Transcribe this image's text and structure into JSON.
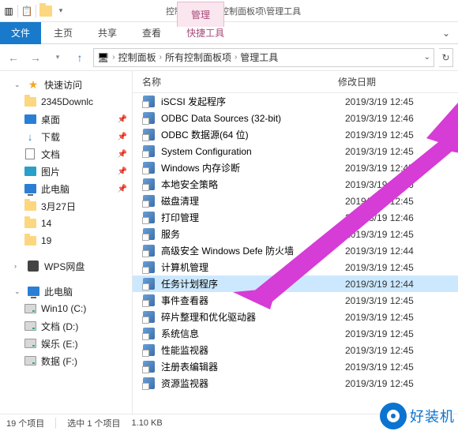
{
  "title_path": "控制面板\\所有控制面板项\\管理工具",
  "ribbon": {
    "manage_tab": "管理",
    "file": "文件",
    "home": "主页",
    "share": "共享",
    "view": "查看",
    "tools": "快捷工具"
  },
  "breadcrumb": {
    "seg1": "控制面板",
    "seg2": "所有控制面板项",
    "seg3": "管理工具"
  },
  "columns": {
    "name": "名称",
    "date": "修改日期"
  },
  "sidebar": {
    "quick": "快速访问",
    "items": [
      {
        "label": "2345Downlc"
      },
      {
        "label": "桌面"
      },
      {
        "label": "下载"
      },
      {
        "label": "文档"
      },
      {
        "label": "图片"
      },
      {
        "label": "此电脑"
      },
      {
        "label": "3月27日"
      },
      {
        "label": "14"
      },
      {
        "label": "19"
      }
    ],
    "wps": "WPS网盘",
    "thispc": "此电脑",
    "drives": [
      {
        "label": "Win10 (C:)"
      },
      {
        "label": "文档 (D:)"
      },
      {
        "label": "娱乐 (E:)"
      },
      {
        "label": "数据 (F:)"
      }
    ]
  },
  "files": [
    {
      "name": "iSCSI 发起程序",
      "date": "2019/3/19 12:45"
    },
    {
      "name": "ODBC Data Sources (32-bit)",
      "date": "2019/3/19 12:46"
    },
    {
      "name": "ODBC 数据源(64 位)",
      "date": "2019/3/19 12:45"
    },
    {
      "name": "System Configuration",
      "date": "2019/3/19 12:45"
    },
    {
      "name": "Windows 内存诊断",
      "date": "2019/3/19 12:45"
    },
    {
      "name": "本地安全策略",
      "date": "2019/3/19 12:46"
    },
    {
      "name": "磁盘清理",
      "date": "2019/3/19 12:45"
    },
    {
      "name": "打印管理",
      "date": "2019/3/19 12:46"
    },
    {
      "name": "服务",
      "date": "2019/3/19 12:45"
    },
    {
      "name": "高级安全 Windows Defe         防火墙",
      "date": "2019/3/19 12:44"
    },
    {
      "name": "计算机管理",
      "date": "2019/3/19 12:45"
    },
    {
      "name": "任务计划程序",
      "date": "2019/3/19 12:44",
      "selected": true
    },
    {
      "name": "事件查看器",
      "date": "2019/3/19 12:45"
    },
    {
      "name": "碎片整理和优化驱动器",
      "date": "2019/3/19 12:45"
    },
    {
      "name": "系统信息",
      "date": "2019/3/19 12:45"
    },
    {
      "name": "性能监视器",
      "date": "2019/3/19 12:45"
    },
    {
      "name": "注册表编辑器",
      "date": "2019/3/19 12:45"
    },
    {
      "name": "资源监视器",
      "date": "2019/3/19 12:45"
    }
  ],
  "status": {
    "count": "19 个项目",
    "selected": "选中 1 个项目",
    "size": "1.10 KB"
  },
  "watermark": "好装机",
  "annotation_arrow_color": "#d63cd6"
}
